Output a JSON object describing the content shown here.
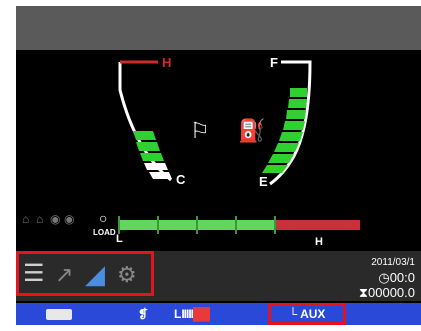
{
  "gauges": {
    "temp": {
      "high_label": "H",
      "low_label": "C",
      "level": 0.45
    },
    "fuel": {
      "full_label": "F",
      "empty_label": "E",
      "level": 0.85
    }
  },
  "load": {
    "low_label": "L",
    "high_label": "H",
    "icon_text": "LOAD",
    "level": 0.65
  },
  "status": {
    "date": "2011/03/1",
    "time": "00:0",
    "hours": "00000.0"
  },
  "bottom_bar": {
    "button2_label": "❡",
    "gear_left": "L",
    "gear_bars": "IIIII",
    "aux_label": "AUX",
    "aux_icon": "└"
  },
  "colors": {
    "gauge_green": "#2fd02f",
    "warning_red": "#d12a2a",
    "bar_blue": "#2b49d8",
    "highlight_red": "#e4141e"
  }
}
